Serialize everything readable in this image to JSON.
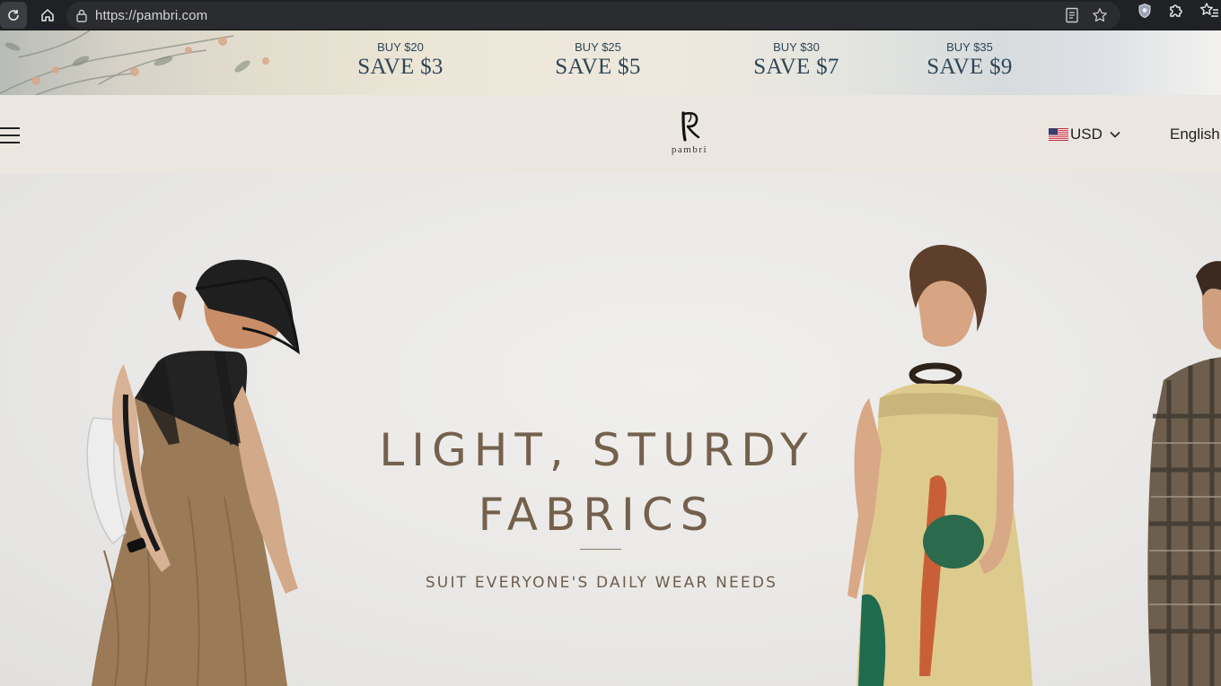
{
  "browser": {
    "url": "https://pambri.com",
    "icons": [
      "reload-icon",
      "home-icon",
      "lock-icon",
      "reader-icon",
      "star-icon",
      "shield-extension-icon",
      "puzzle-extension-icon",
      "favorites-icon"
    ]
  },
  "promo": {
    "offers": [
      {
        "small": "BUY $20",
        "big": "SAVE $3"
      },
      {
        "small": "BUY $25",
        "big": "SAVE $5"
      },
      {
        "small": "BUY $30",
        "big": "SAVE $7"
      },
      {
        "small": "BUY $35",
        "big": "SAVE $9"
      }
    ],
    "text_color": "#2f4556"
  },
  "header": {
    "logo_text": "pambri",
    "currency": "USD",
    "language": "English",
    "icons": [
      "menu-icon",
      "us-flag-icon",
      "chevron-down-icon"
    ]
  },
  "hero": {
    "headline_line1": "LIGHT, STURDY",
    "headline_line2": "FABRICS",
    "subline": "SUIT EVERYONE'S DAILY WEAR NEEDS",
    "text_color": "#73614c"
  }
}
